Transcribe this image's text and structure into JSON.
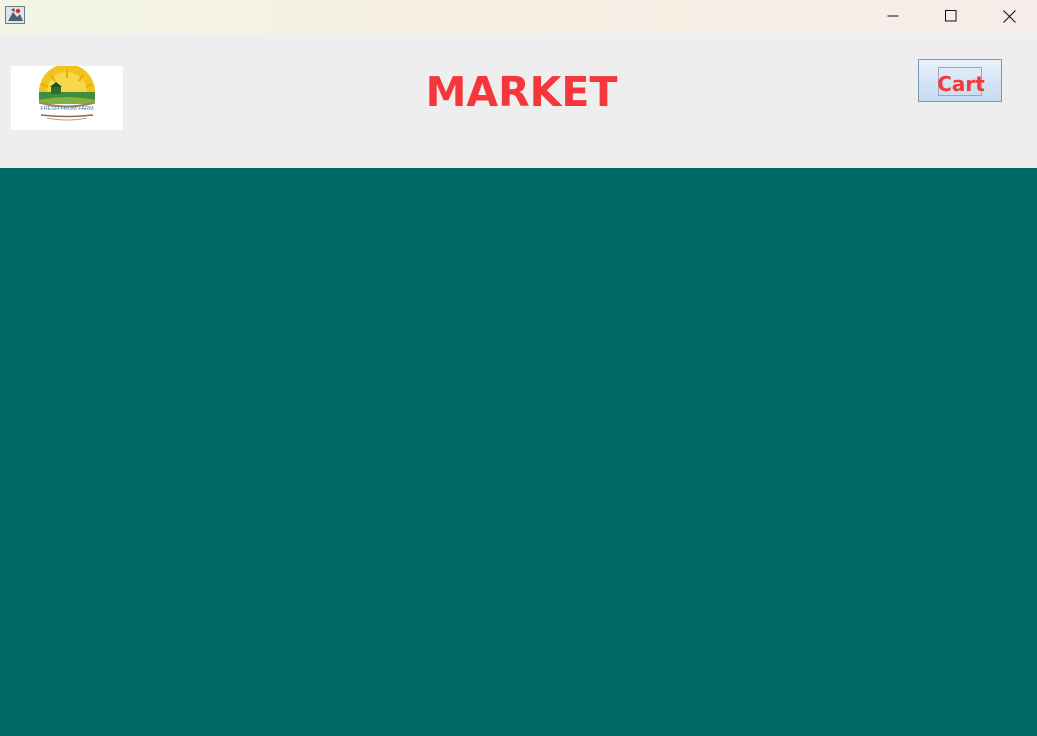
{
  "window": {
    "app_icon": "java-app-icon",
    "controls": {
      "minimize_icon": "minimize-icon",
      "maximize_icon": "maximize-icon",
      "close_icon": "close-icon"
    }
  },
  "header": {
    "logo_text": "FRESH FROM FARM",
    "title": "MARKET",
    "cart_label": "Cart"
  },
  "colors": {
    "accent_red": "#f5363a",
    "content_bg": "#006968",
    "header_bg": "#eeeeee"
  }
}
